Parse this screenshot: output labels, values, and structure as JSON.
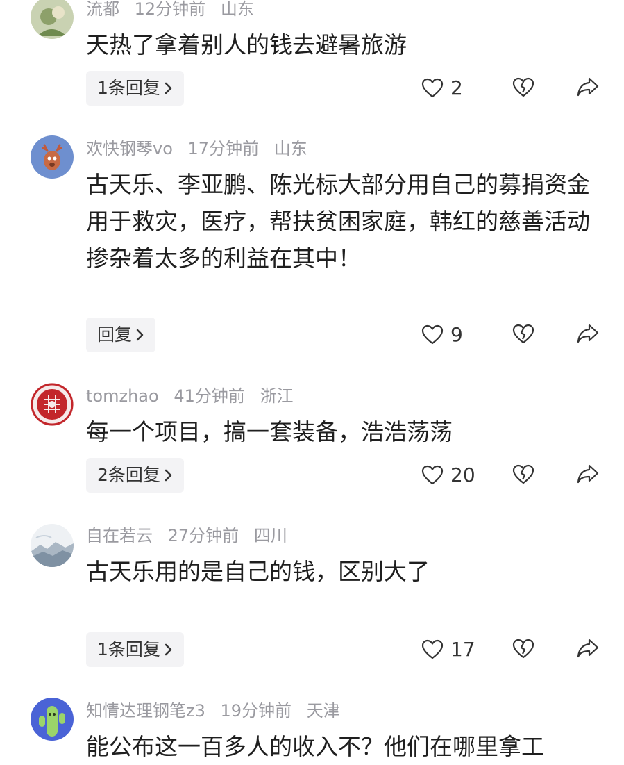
{
  "comments": [
    {
      "user": "流都",
      "time": "12分钟前",
      "location": "山东",
      "text": "天热了拿着别人的钱去避暑旅游",
      "reply_label": "1条回复",
      "likes": "2",
      "avatar_icon": "flower-avatar"
    },
    {
      "user": "欢快钢琴vo",
      "time": "17分钟前",
      "location": "山东",
      "text": "古天乐、李亚鹏、陈光标大部分用自己的募捐资金用于救灾，医疗，帮扶贫困家庭，韩红的慈善活动掺杂着太多的利益在其中！",
      "reply_label": "回复",
      "likes": "9",
      "avatar_icon": "deer-avatar"
    },
    {
      "user": "tomzhao",
      "time": "41分钟前",
      "location": "浙江",
      "text": "每一个项目，搞一套装备，浩浩荡荡",
      "reply_label": "2条回复",
      "likes": "20",
      "avatar_icon": "papercut-avatar"
    },
    {
      "user": "自在若云",
      "time": "27分钟前",
      "location": "四川",
      "text": "古天乐用的是自己的钱，区别大了",
      "reply_label": "1条回复",
      "likes": "17",
      "avatar_icon": "mountain-avatar"
    },
    {
      "user": "知情达理钢笔z3",
      "time": "19分钟前",
      "location": "天津",
      "text": "能公布这一百多人的收入不？他们在哪里拿工",
      "avatar_icon": "cactus-avatar"
    }
  ]
}
